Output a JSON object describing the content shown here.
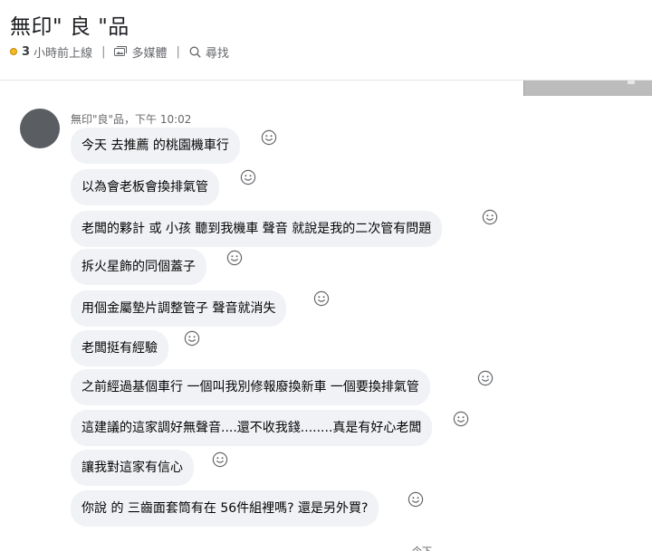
{
  "header": {
    "title": "無印\" 良 \"品",
    "online_count": "3",
    "online_text": "小時前上線",
    "multimedia_label": "多媒體",
    "search_label": "尋找",
    "separator": "|"
  },
  "conversation": {
    "sender_meta": "無印\"良\"品，下午 10:02",
    "messages": [
      "今天 去推薦 的桃園機車行",
      "以為會老板會換排氣管",
      "老闆的夥計 或 小孩 聽到我機車 聲音 就說是我的二次管有問題",
      "拆火星飾的同個蓋子",
      "用個金屬墊片調整管子 聲音就消失",
      "老闆挺有經驗",
      "之前經過基個車行  一個叫我別修報廢換新車  一個要換排氣管",
      "這建議的這家調好無聲音....還不收我錢........真是有好心老闆",
      "讓我對這家有信心",
      "你說 的 三齒面套筒有在 56件組裡嗎? 還是另外買?"
    ],
    "bottom_fragment": "今下"
  },
  "icons": {
    "online_dot": "status-dot-icon",
    "multimedia": "media-icon",
    "search": "search-icon",
    "reaction": "smiley-icon"
  },
  "colors": {
    "bubble_bg": "#f0f2f5",
    "status_dot": "#f7b928",
    "meta_text": "#65676b"
  }
}
